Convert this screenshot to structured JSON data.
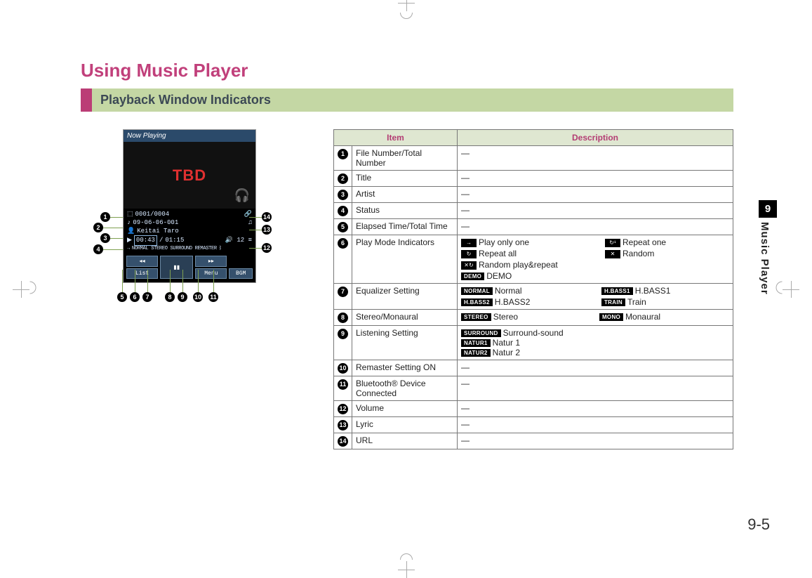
{
  "page": {
    "title": "Using Music Player",
    "section": "Playback Window Indicators",
    "chapter_num": "9",
    "chapter_label": "Music Player",
    "page_number": "9-5"
  },
  "phone": {
    "header": "Now Playing",
    "tbd": "TBD",
    "file_counter": "0001/0004",
    "track_title": "09-06-06-001",
    "artist": "Keitai Taro",
    "elapsed": "00:43",
    "total_time": "01:15",
    "vol": "12",
    "indicator_line": "NORMAL STEREO SURROUND REMASTER",
    "btn_list": "List",
    "btn_prev": "◂◂",
    "btn_pause": "▮▮",
    "btn_next": "▸▸",
    "btn_menu": "Menu",
    "btn_bgm": "BGM"
  },
  "table": {
    "headers": {
      "item": "Item",
      "desc": "Description"
    },
    "rows": [
      {
        "n": "1",
        "item": "File Number/Total Number",
        "desc": "―"
      },
      {
        "n": "2",
        "item": "Title",
        "desc": "―"
      },
      {
        "n": "3",
        "item": "Artist",
        "desc": "―"
      },
      {
        "n": "4",
        "item": "Status",
        "desc": "―"
      },
      {
        "n": "5",
        "item": "Elapsed Time/Total Time",
        "desc": "―"
      },
      {
        "n": "6",
        "item": "Play Mode Indicators",
        "desc_type": "playmode"
      },
      {
        "n": "7",
        "item": "Equalizer Setting",
        "desc_type": "eq"
      },
      {
        "n": "8",
        "item": "Stereo/Monaural",
        "desc_type": "stereo"
      },
      {
        "n": "9",
        "item": "Listening Setting",
        "desc_type": "listen"
      },
      {
        "n": "10",
        "item": "Remaster Setting ON",
        "desc": "―"
      },
      {
        "n": "11",
        "item": "Bluetooth® Device Connected",
        "desc": "―"
      },
      {
        "n": "12",
        "item": "Volume",
        "desc": "―"
      },
      {
        "n": "13",
        "item": "Lyric",
        "desc": "―"
      },
      {
        "n": "14",
        "item": "URL",
        "desc": "―"
      }
    ]
  },
  "desc": {
    "playmode": {
      "a1": "Play only one",
      "a2": "Repeat one",
      "b1": "Repeat all",
      "b2": "Random",
      "c1": "Random play&repeat",
      "d1": "DEMO"
    },
    "eq": {
      "normal": "Normal",
      "hbass1": "H.BASS1",
      "hbass2": "H.BASS2",
      "train": "Train",
      "tag_normal": "NORMAL",
      "tag_hbass1": "H.BASS1",
      "tag_hbass2": "H.BASS2",
      "tag_train": "TRAIN"
    },
    "stereo": {
      "stereo": "Stereo",
      "mono": "Monaural",
      "tag_stereo": "STEREO",
      "tag_mono": "MONO"
    },
    "listen": {
      "surround": "Surround-sound",
      "natur1": "Natur 1",
      "natur2": "Natur 2",
      "tag_surround": "SURROUND",
      "tag_natur1": "NATUR1",
      "tag_natur2": "NATUR2"
    },
    "demo_tag": "DEMO"
  },
  "callouts": [
    "1",
    "2",
    "3",
    "4",
    "5",
    "6",
    "7",
    "8",
    "9",
    "10",
    "11",
    "12",
    "13",
    "14"
  ]
}
